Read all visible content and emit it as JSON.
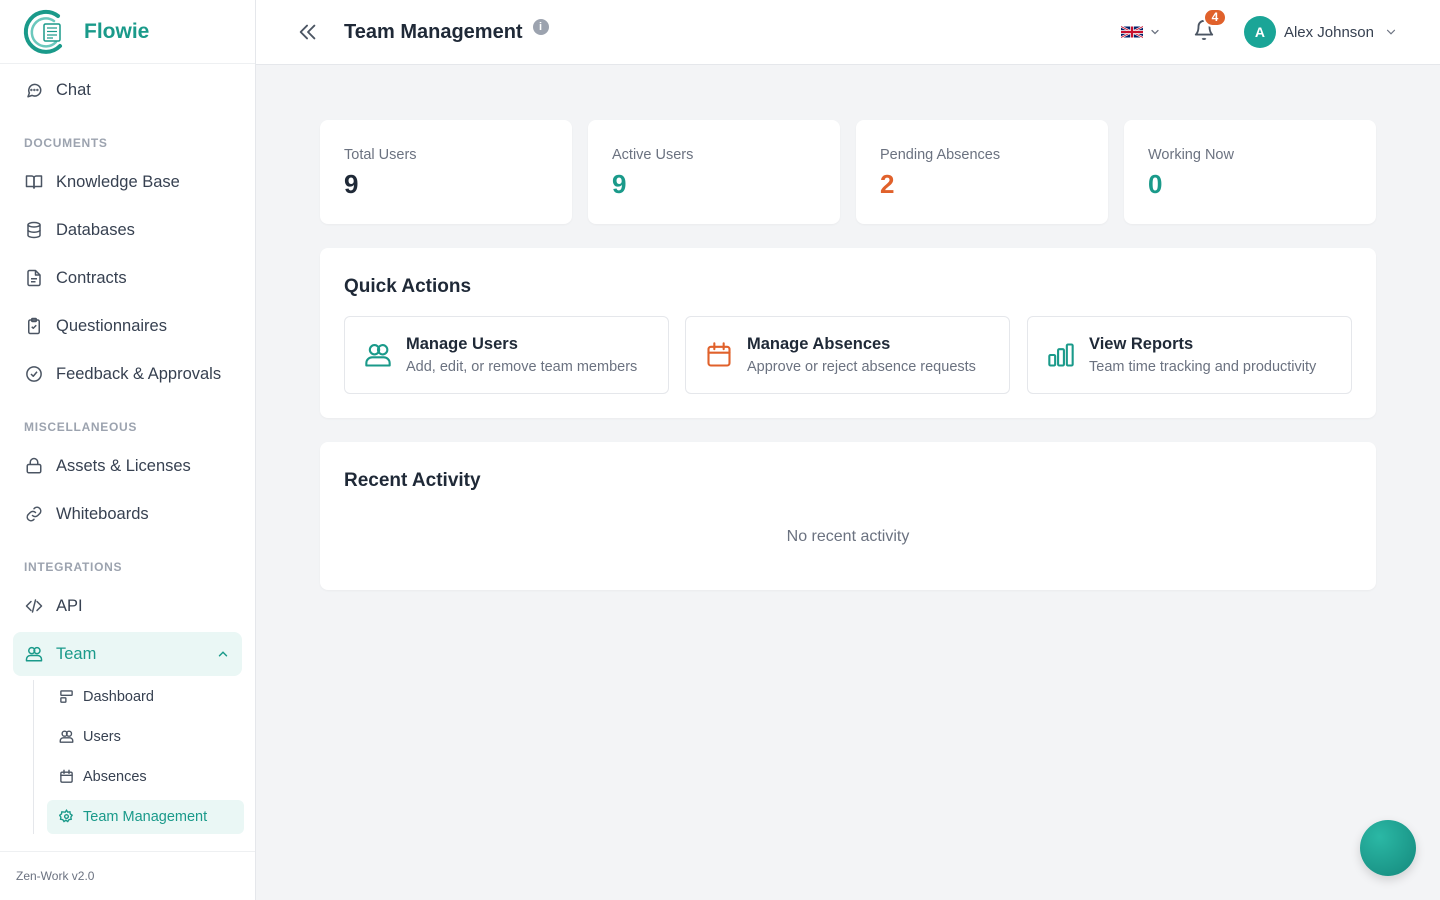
{
  "brand": {
    "name": "Flowie"
  },
  "sidebar": {
    "chat": "Chat",
    "sections": {
      "documents": "DOCUMENTS",
      "miscellaneous": "MISCELLANEOUS",
      "integrations": "INTEGRATIONS"
    },
    "documents": [
      "Knowledge Base",
      "Databases",
      "Contracts",
      "Questionnaires",
      "Feedback & Approvals"
    ],
    "miscellaneous": [
      "Assets & Licenses",
      "Whiteboards"
    ],
    "api": "API",
    "team": "Team",
    "team_sub": [
      "Dashboard",
      "Users",
      "Absences",
      "Team Management"
    ],
    "version": "Zen-Work v2.0"
  },
  "header": {
    "title": "Team Management",
    "info_glyph": "i",
    "notifications_count": "4",
    "user_initial": "A",
    "user_name": "Alex Johnson"
  },
  "stats": [
    {
      "label": "Total Users",
      "value": "9",
      "color": "#1f2937"
    },
    {
      "label": "Active Users",
      "value": "9",
      "color": "#1a9a8a"
    },
    {
      "label": "Pending Absences",
      "value": "2",
      "color": "#e0612b"
    },
    {
      "label": "Working Now",
      "value": "0",
      "color": "#1a9a8a"
    }
  ],
  "quick_actions": {
    "title": "Quick Actions",
    "items": [
      {
        "title": "Manage Users",
        "desc": "Add, edit, or remove team members",
        "icon": "users-icon",
        "color": "#1a9a8a"
      },
      {
        "title": "Manage Absences",
        "desc": "Approve or reject absence requests",
        "icon": "calendar-icon",
        "color": "#e0612b"
      },
      {
        "title": "View Reports",
        "desc": "Team time tracking and productivity",
        "icon": "bar-chart-icon",
        "color": "#1a9a8a"
      }
    ]
  },
  "recent_activity": {
    "title": "Recent Activity",
    "empty": "No recent activity"
  },
  "colors": {
    "accent": "#1a9a8a",
    "warning": "#e0612b"
  }
}
